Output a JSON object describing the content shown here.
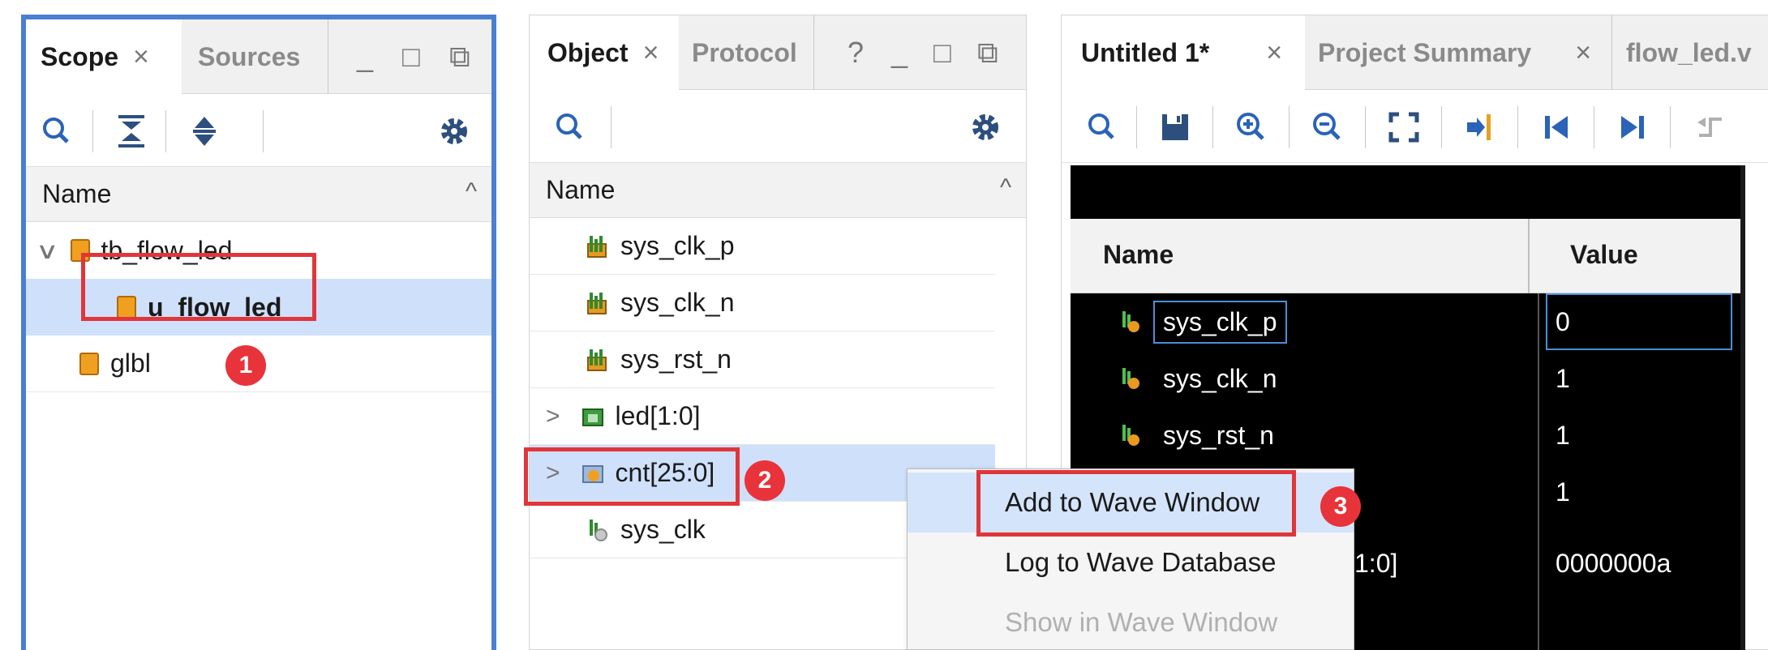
{
  "scope_panel": {
    "tabs": [
      {
        "label": "Scope",
        "selected": true,
        "closable": true
      },
      {
        "label": "Sources",
        "selected": false,
        "closable": false
      }
    ],
    "window_controls": [
      "_",
      "□",
      "⧉"
    ],
    "toolbar": [
      "search-icon",
      "collapse-all-icon",
      "expand-all-icon",
      "gear-icon"
    ],
    "column_header": "Name",
    "tree": [
      {
        "label": "tb_flow_led",
        "level": 0,
        "expanded": true
      },
      {
        "label": "u_flow_led",
        "level": 1,
        "selected": true
      },
      {
        "label": "glbl",
        "level": 0
      }
    ],
    "badge": "1"
  },
  "object_panel": {
    "tabs": [
      {
        "label": "Object",
        "selected": true,
        "closable": true
      },
      {
        "label": "Protocol",
        "selected": false,
        "closable": false
      }
    ],
    "window_controls": [
      "?",
      "_",
      "□",
      "⧉"
    ],
    "toolbar": [
      "search-icon",
      "gear-icon"
    ],
    "column_header": "Name",
    "rows": [
      {
        "label": "sys_clk_p",
        "expandable": false
      },
      {
        "label": "sys_clk_n",
        "expandable": false
      },
      {
        "label": "sys_rst_n",
        "expandable": false
      },
      {
        "label": "led[1:0]",
        "expandable": true
      },
      {
        "label": "cnt[25:0]",
        "expandable": true,
        "selected": true
      },
      {
        "label": "sys_clk",
        "expandable": false
      }
    ],
    "badge": "2"
  },
  "context_menu": {
    "items": [
      {
        "label": "Add to Wave Window",
        "highlighted": true,
        "enabled": true
      },
      {
        "label": "Log to Wave Database",
        "highlighted": false,
        "enabled": true
      },
      {
        "label": "Show in Wave Window",
        "highlighted": false,
        "enabled": false
      }
    ],
    "badge": "3"
  },
  "wave_panel": {
    "tabs": [
      {
        "label": "Untitled 1*",
        "selected": true,
        "closable": true
      },
      {
        "label": "Project Summary",
        "selected": false,
        "closable": true
      },
      {
        "label": "flow_led.v",
        "selected": false,
        "closable": false
      }
    ],
    "toolbar": [
      "search-icon",
      "save-icon",
      "zoom-in-icon",
      "zoom-out-icon",
      "zoom-fit-icon",
      "go-to-cursor-icon",
      "go-to-start-icon",
      "go-to-end-icon",
      "previous-transition-icon"
    ],
    "columns": [
      "Name",
      "Value"
    ],
    "signals": [
      {
        "name": "sys_clk_p",
        "value": "0"
      },
      {
        "name": "sys_clk_n",
        "value": "1"
      },
      {
        "name": "sys_rst_n",
        "value": "1"
      },
      {
        "name": "",
        "value": "1"
      },
      {
        "name": "1:0]",
        "value": "0000000a"
      }
    ]
  },
  "colors": {
    "accent_border": "#4a7fd2",
    "annotation_red": "#e0363a",
    "selection": "#cfe0fa"
  }
}
